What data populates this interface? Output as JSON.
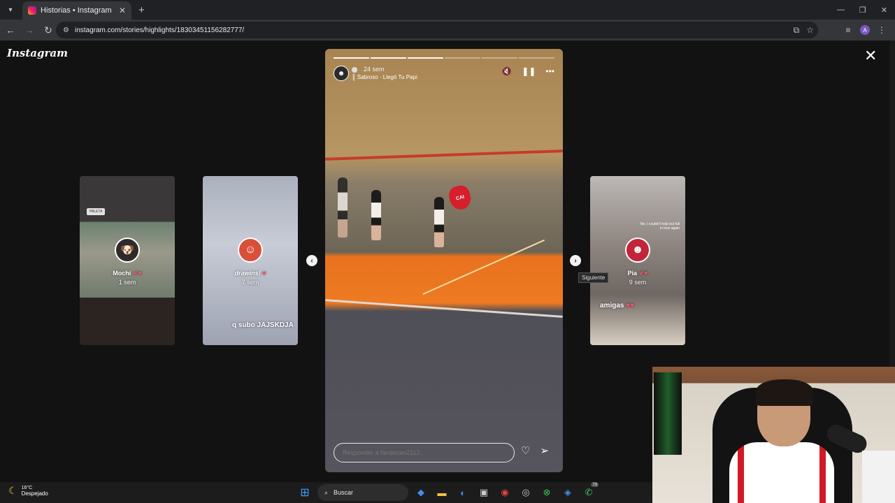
{
  "browser": {
    "tab_title": "Historias • Instagram",
    "new_tab": "+",
    "url": "instagram.com/stories/highlights/18303451156282777/"
  },
  "page": {
    "logo": "Instagram"
  },
  "side_stories": [
    {
      "name": "Mochi",
      "time": "1 sem",
      "tag": "PALETA"
    },
    {
      "name": "drawins!",
      "time": "7 sem",
      "caption": "q subo JAJSKDJA"
    },
    {
      "name": "Pia",
      "time": "9 sem",
      "caption": "amigas",
      "note": "No, I couldn't help but fall in love again"
    }
  ],
  "story": {
    "time": "24 sem",
    "music": "Sabroso · Llegó Tu Papi",
    "reply_placeholder": "Responder a fandecan2112...",
    "progress_total": 6,
    "progress_done": 3
  },
  "tooltip": "Siguiente",
  "taskbar": {
    "temperature": "16°C",
    "weather": "Despejado",
    "search": "Buscar",
    "badge": "73"
  },
  "icons": {
    "back": "arrow-left-icon",
    "forward": "arrow-right-icon",
    "reload": "reload-icon",
    "close": "close-icon",
    "mute": "mute-icon",
    "pause": "pause-icon",
    "more": "more-icon",
    "like": "heart-icon",
    "share": "send-icon"
  }
}
